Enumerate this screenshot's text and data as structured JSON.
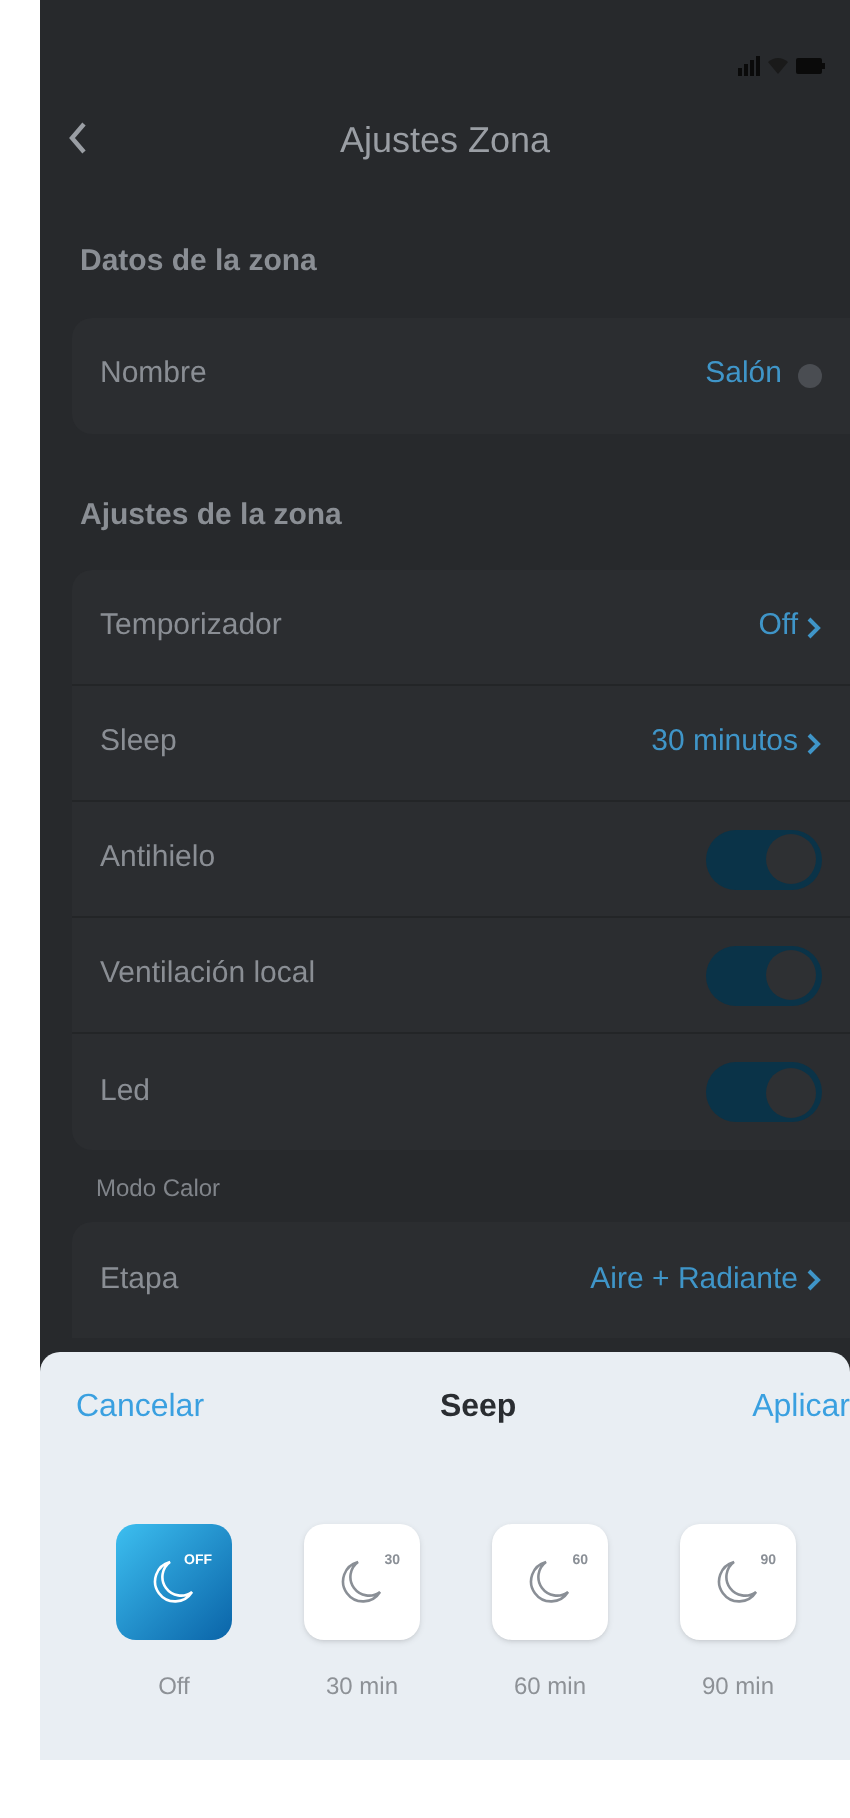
{
  "header": {
    "title": "Ajustes Zona"
  },
  "sections": [
    {
      "title": "Datos de la zona",
      "rows": [
        {
          "kind": "editable",
          "label": "Nombre",
          "value": "Salón"
        }
      ]
    },
    {
      "title": "Ajustes de la zona",
      "rows": [
        {
          "kind": "link",
          "label": "Temporizador",
          "value": "Off"
        },
        {
          "kind": "link",
          "label": "Sleep",
          "value": "30 minutos"
        },
        {
          "kind": "toggle",
          "label": "Antihielo",
          "on": true
        },
        {
          "kind": "toggle",
          "label": "Ventilación local",
          "on": true
        },
        {
          "kind": "toggle",
          "label": "Led",
          "on": true
        }
      ]
    }
  ],
  "subsection": {
    "title": "Modo Calor",
    "rows": [
      {
        "kind": "link",
        "label": "Etapa",
        "value": "Aire + Radiante"
      }
    ]
  },
  "sheet": {
    "cancel": "Cancelar",
    "title": "Seep",
    "apply": "Aplicar",
    "options": [
      {
        "badge": "OFF",
        "label": "Off",
        "selected": true
      },
      {
        "badge": "30",
        "label": "30 min",
        "selected": false
      },
      {
        "badge": "60",
        "label": "60 min",
        "selected": false
      },
      {
        "badge": "90",
        "label": "90 min",
        "selected": false
      }
    ]
  }
}
